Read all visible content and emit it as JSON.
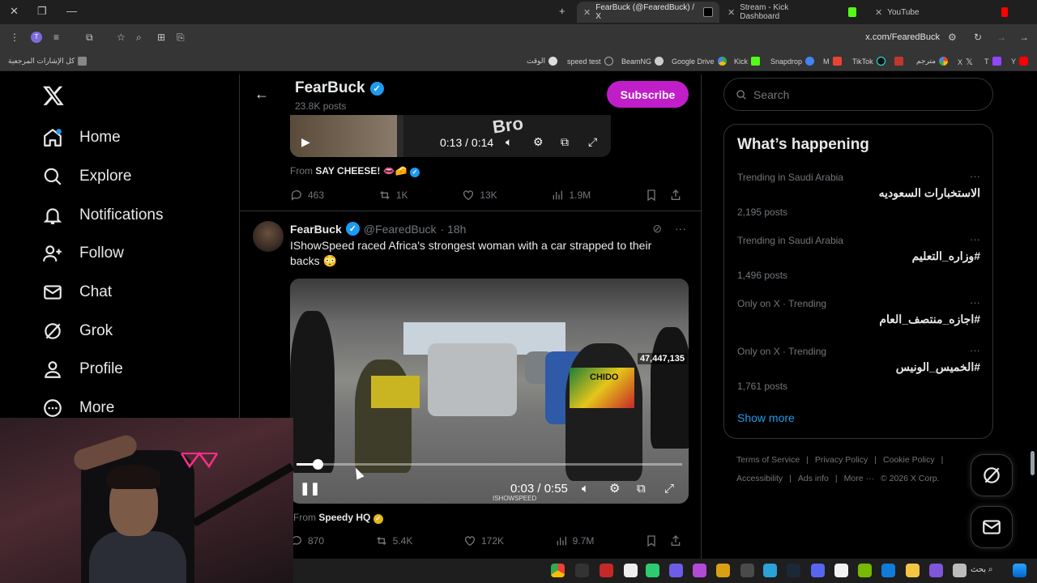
{
  "browser": {
    "tabs": [
      {
        "title": "FearBuck (@FearedBuck) / X",
        "active": true
      },
      {
        "title": "Stream - Kick Dashboard"
      },
      {
        "title": "YouTube"
      }
    ],
    "url": "x.com/FearedBuck",
    "bookmarks": [
      "كل الإشارات المرجعية",
      "الوقت",
      "speed test",
      "BeamNG",
      "Google Drive",
      "Kick",
      "Snapdrop",
      "M",
      "TikTok",
      "مترجم",
      "X",
      "T",
      "Y"
    ]
  },
  "nav": {
    "items": [
      "Home",
      "Explore",
      "Notifications",
      "Follow",
      "Chat",
      "Grok",
      "Profile",
      "More"
    ]
  },
  "profile_header": {
    "name": "FearBuck",
    "posts": "23.8K posts",
    "subscribe_label": "Subscribe"
  },
  "post1": {
    "video_time": "0:13 / 0:14",
    "video_overlay_text": "Bro",
    "from_label": "From",
    "from_account": "SAY CHEESE! 👄🧀",
    "stats": {
      "replies": "463",
      "reposts": "1K",
      "likes": "13K",
      "views": "1.9M"
    }
  },
  "post2": {
    "author_name": "FearBuck",
    "handle": "@FearedBuck",
    "time": "· 18h",
    "text": "IShowSpeed raced Africa's strongest woman with a car strapped to their backs 😳",
    "video": {
      "time": "0:03 / 0:55",
      "counter": "47,447,135",
      "watermark": "ISHOWSPEED",
      "jersey_text": "CHIDO",
      "progress": 0.055
    },
    "from_label": "From",
    "from_account": "Speedy HQ",
    "stats": {
      "replies": "870",
      "reposts": "5.4K",
      "likes": "172K",
      "views": "9.7M"
    }
  },
  "search": {
    "placeholder": "Search"
  },
  "trending": {
    "title": "What’s happening",
    "items": [
      {
        "context": "Trending in Saudi Arabia",
        "name": "الاستخبارات السعوديه",
        "count": "2,195 posts"
      },
      {
        "context": "Trending in Saudi Arabia",
        "name": "#وزاره_التعليم",
        "count": "1,496 posts"
      },
      {
        "context": "Only on X · Trending",
        "name": "#اجازه_منتصف_العام",
        "count": ""
      },
      {
        "context": "Only on X · Trending",
        "name": "#الخميس_الونيس",
        "count": "1,761 posts"
      }
    ],
    "show_more": "Show more"
  },
  "footer": {
    "row1": [
      "Terms of Service",
      "|",
      "Privacy Policy",
      "|",
      "Cookie Policy",
      "|"
    ],
    "row2": [
      "Accessibility",
      "|",
      "Ads info",
      "|",
      "More ···",
      "© 2026 X Corp."
    ]
  },
  "taskbar": {
    "search_label": "بحث"
  },
  "colors": {
    "accent": "#1d9bf0",
    "subscribe": "#c01ec8",
    "verified_gold": "#e2b719"
  }
}
